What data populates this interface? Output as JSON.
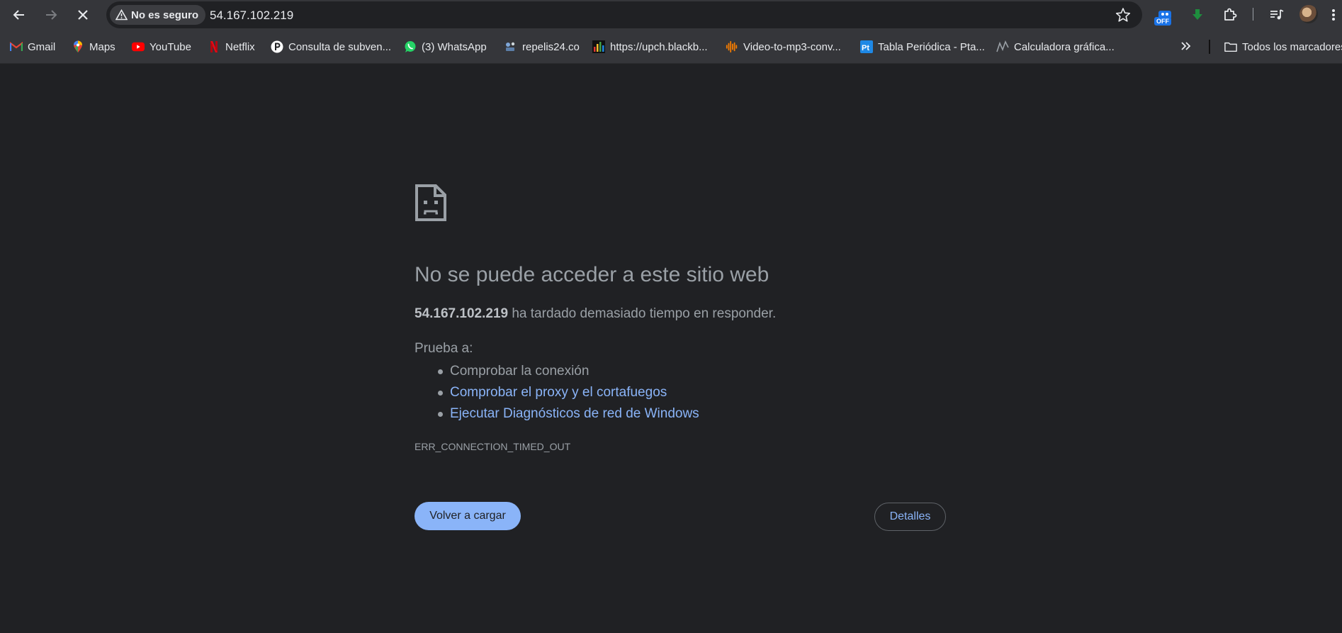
{
  "toolbar": {
    "security_label": "No es seguro",
    "url": "54.167.102.219",
    "ext_badge": "OFF"
  },
  "bookmarks": [
    {
      "label": "Gmail",
      "icon": "gmail-icon",
      "color": "#ea4335"
    },
    {
      "label": "Maps",
      "icon": "maps-icon",
      "color": "#34a853"
    },
    {
      "label": "YouTube",
      "icon": "youtube-icon",
      "color": "#ff0000"
    },
    {
      "label": "Netflix",
      "icon": "netflix-icon",
      "color": "#e50914"
    },
    {
      "label": "Consulta de subven...",
      "icon": "p-circle-icon",
      "color": "#ffffff"
    },
    {
      "label": "(3) WhatsApp",
      "icon": "whatsapp-icon",
      "color": "#25d366"
    },
    {
      "label": "repelis24.co",
      "icon": "repelis-icon",
      "color": "#7fa7d8"
    },
    {
      "label": "https://upch.blackb...",
      "icon": "blackboard-icon",
      "color": "#f4b400"
    },
    {
      "label": "Video-to-mp3-conv...",
      "icon": "audio-wave-icon",
      "color": "#f57c00"
    },
    {
      "label": "Tabla Periódica - Pta...",
      "icon": "ptable-icon",
      "color": "#1e88e5"
    },
    {
      "label": "Calculadora gráfica...",
      "icon": "graph-icon",
      "color": "#9aa0a6"
    }
  ],
  "bookmarks_folder": {
    "label": "Todos los marcadores"
  },
  "error": {
    "title": "No se puede acceder a este sitio web",
    "host": "54.167.102.219",
    "summary_rest": " ha tardado demasiado tiempo en responder.",
    "try_label": "Prueba a:",
    "suggestions": [
      {
        "text": "Comprobar la conexión",
        "link": false
      },
      {
        "text": "Comprobar el proxy y el cortafuegos",
        "link": true
      },
      {
        "text": "Ejecutar Diagnósticos de red de Windows",
        "link": true
      }
    ],
    "code": "ERR_CONNECTION_TIMED_OUT",
    "reload_label": "Volver a cargar",
    "details_label": "Detalles"
  },
  "colors": {
    "page_bg": "#202124",
    "toolbar_bg": "#35363a",
    "link": "#8ab4f8",
    "muted_text": "#9aa0a6"
  }
}
